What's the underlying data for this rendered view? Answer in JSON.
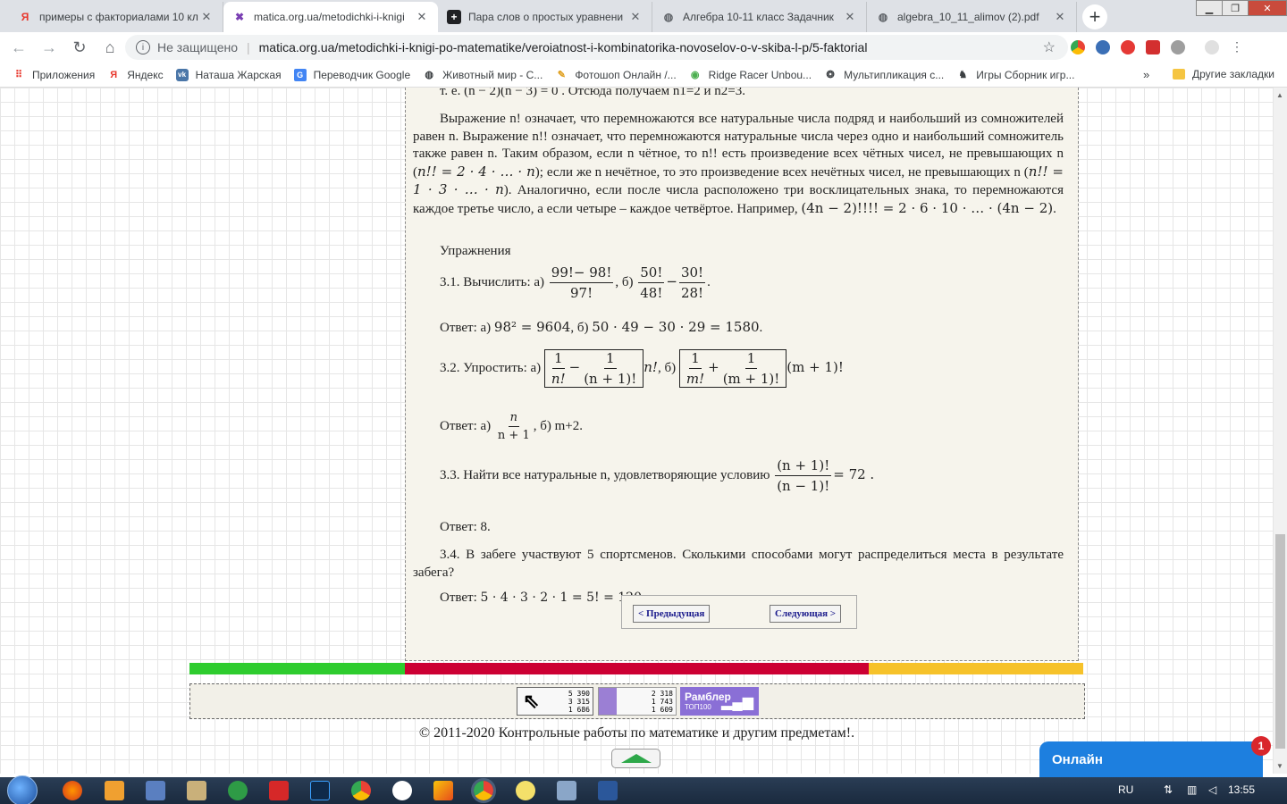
{
  "browser": {
    "tabs": [
      {
        "title": "примеры с факториалами 10 кл",
        "icon": "yandex-icon",
        "color": "#e8372c"
      },
      {
        "title": "matica.org.ua/metodichki-i-knigi",
        "icon": "matica-icon",
        "color": "#7a3fb3"
      },
      {
        "title": "Пара слов о простых уравнени",
        "icon": "plus-box-icon",
        "color": "#202124"
      },
      {
        "title": "Алгебра 10-11 класс Задачник",
        "icon": "globe-icon",
        "color": "#5f6368"
      },
      {
        "title": "algebra_10_11_alimov (2).pdf",
        "icon": "globe-icon",
        "color": "#5f6368"
      }
    ],
    "security_label": "Не защищено",
    "url": "matica.org.ua/metodichki-i-knigi-po-matematike/veroiatnost-i-kombinatorika-novoselov-o-v-skiba-l-p/5-faktorial",
    "bookmarks": [
      {
        "label": "Приложения",
        "icon": "apps-icon",
        "color": "#e8372c"
      },
      {
        "label": "Яндекс",
        "icon": "yandex-icon",
        "color": "#e8372c"
      },
      {
        "label": "Наташа Жарская",
        "icon": "vk-icon",
        "color": "#4a76a8"
      },
      {
        "label": "Переводчик Google",
        "icon": "translate-icon",
        "color": "#4285f4"
      },
      {
        "label": "Животный мир - С...",
        "icon": "globe-icon",
        "color": "#333"
      },
      {
        "label": "Фотошоп Онлайн /...",
        "icon": "photoshop-icon",
        "color": "#e0a020"
      },
      {
        "label": "Ridge Racer Unbou...",
        "icon": "ridge-icon",
        "color": "#4caf50"
      },
      {
        "label": "Мультипликация с...",
        "icon": "cartoon-icon",
        "color": "#333"
      },
      {
        "label": "Игры Сборник игр...",
        "icon": "games-icon",
        "color": "#333"
      }
    ],
    "bookmarks_more": "»",
    "other_bookmarks": "Другие закладки"
  },
  "content": {
    "top_partial": "т. е. (n − 2)(n − 3) = 0 . Отсюда получаем n1=2 и n2=3.",
    "paragraph": {
      "p1": "Выражение n! означает, что перемножаются все натуральные числа подряд и наибольший из сомножителей равен n. Выражение n!! означает, что перемножаются натуральные числа через одно и наибольший сомножитель также равен n. Таким образом, если n чётное, то n!! есть произведение всех чётных чисел, не превышающих n (",
      "m1": "n!! = 2 · 4 · … · n",
      "p2": "); если же n нечётное, то это произведение всех нечётных чисел, не превышающих n (",
      "m2": "n!! = 1 · 3 · … · n",
      "p3": "). Аналогично, если после числа расположено три восклицательных знака, то перемножаются каждое третье число, а если четыре – каждое четвёртое. Например,",
      "m3": "(4n − 2)!!!! = 2 · 6 · 10 · … · (4n − 2)",
      "p4": "."
    },
    "exercises_heading": "Упражнения",
    "ex1": {
      "label": "3.1. Вычислить: а)",
      "a_num": "99!− 98!",
      "a_den": "97!",
      "sep": ", б)",
      "b1_num": "50!",
      "b1_den": "48!",
      "minus": "−",
      "b2_num": "30!",
      "b2_den": "28!",
      "end": "."
    },
    "ans1": {
      "label": "Ответ: а)",
      "a": "98² = 9604",
      "sep": ", б)",
      "b": "50 · 49 − 30 · 29 = 1580",
      "end": "."
    },
    "ex2": {
      "label": "3.2. Упростить: а)",
      "a1_num": "1",
      "a1_den": "n!",
      "minus": "−",
      "a2_num": "1",
      "a2_den": "(n + 1)!",
      "a_tail": "n!",
      "sep": ", б)",
      "b1_num": "1",
      "b1_den": "m!",
      "plus": "+",
      "b2_num": "1",
      "b2_den": "(m + 1)!",
      "b_tail": "(m + 1)!"
    },
    "ans2": {
      "label": "Ответ: а)",
      "num": "n",
      "den": "n + 1",
      "tail": ", б) m+2."
    },
    "ex3": {
      "label": "3.3. Найти все натуральные n, удовлетворяющие условию",
      "num": "(n + 1)!",
      "den": "(n − 1)!",
      "tail": "= 72 ."
    },
    "ans3": "Ответ: 8.",
    "ex4": "3.4. В забеге участвуют 5 спортсменов. Сколькими способами могут распределиться места в результате забега?",
    "ans4": {
      "label": "Ответ:",
      "expr": "5 · 4 · 3 · 2 · 1 = 5! = 120",
      "end": "."
    },
    "prev_label": "< Предыдущая",
    "next_label": "Следующая >"
  },
  "stripe_colors": [
    "#2ecc2e",
    "#cc0033",
    "#f6c22a"
  ],
  "counters": {
    "c1": [
      "5 390",
      "3 315",
      "1 686"
    ],
    "c2": [
      "2 318",
      "1 743",
      "1 609"
    ],
    "rambler_title": "Рамблер",
    "rambler_sub": "ТОП100"
  },
  "footer": {
    "copyright": "© 2011-2020 Контрольные работы по математике и другим предметам!."
  },
  "chat": {
    "label": "Онлайн",
    "badge": "1"
  },
  "taskbar": {
    "lang": "RU",
    "time": "13:55"
  }
}
